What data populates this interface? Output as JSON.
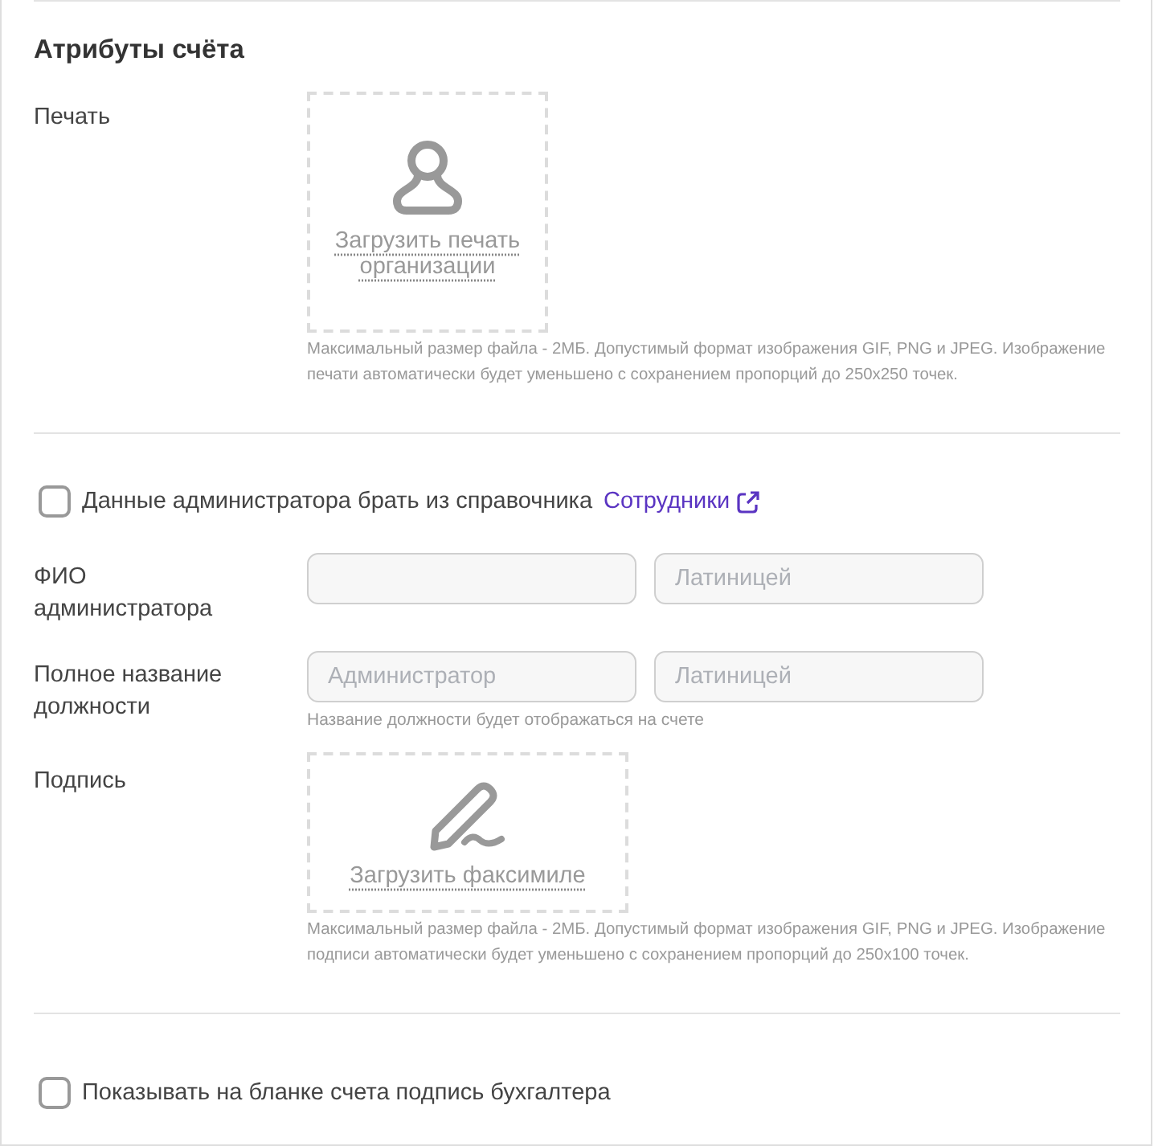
{
  "section": {
    "title": "Атрибуты счёта"
  },
  "stamp": {
    "label": "Печать",
    "upload_text": "Загрузить печать организации",
    "note": "Максимальный размер файла - 2МБ. Допустимый формат изображения GIF, PNG и JPEG. Изображение печати автоматически будет уменьшено с сохранением пропорций до 250x250 точек."
  },
  "admin_from_directory": {
    "checked": false,
    "label": "Данные администратора брать из справочника",
    "link": "Сотрудники"
  },
  "fields": [
    {
      "label": "ФИО администратора",
      "latin_input": {
        "placeholder": "Латиницей"
      }
    },
    {
      "label": "Полное название должности",
      "input": {
        "placeholder": "Администратор"
      },
      "latin_input": {
        "placeholder": "Латиницей"
      },
      "hint": "Название должности будет отображаться на счете"
    }
  ],
  "signature": {
    "label": "Подпись",
    "upload_text": "Загрузить факсимиле",
    "note": "Максимальный размер файла - 2МБ. Допустимый формат изображения GIF, PNG и JPEG. Изображение подписи автоматически будет уменьшено с сохранением пропорций до 250x100 точек."
  },
  "show_accountant_signature": {
    "checked": false,
    "label": "Показывать на бланке счета подпись бухгалтера"
  }
}
